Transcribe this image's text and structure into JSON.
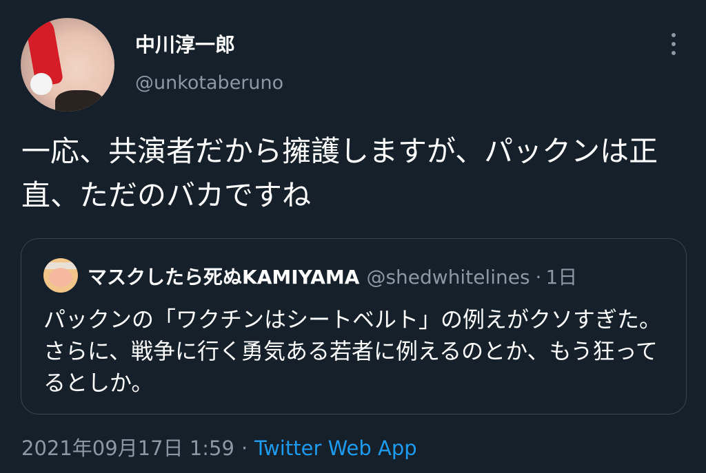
{
  "author": {
    "display_name": "中川淳一郎",
    "username": "@unkotaberuno",
    "avatar_icon": "santa-hat-avatar"
  },
  "menu": {
    "icon": "more-vertical-icon"
  },
  "tweet": {
    "text": "一応、共演者だから擁護しますが、パックンは正直、ただのバカですね"
  },
  "quote": {
    "display_name": "マスクしたら死ぬKAMIYAMA",
    "username": "@shedwhitelines",
    "separator": "·",
    "time": "1日",
    "text": "パックンの「ワクチンはシートベルト」の例えがクソすぎた。さらに、戦争に行く勇気ある若者に例えるのとか、もう狂ってるとしか。"
  },
  "footer": {
    "timestamp": "2021年09月17日 1:59",
    "separator": "·",
    "source": "Twitter Web App"
  },
  "colors": {
    "background": "#15202b",
    "secondary_text": "#8b98a5",
    "link": "#1d9bf0",
    "border": "#38444d"
  }
}
